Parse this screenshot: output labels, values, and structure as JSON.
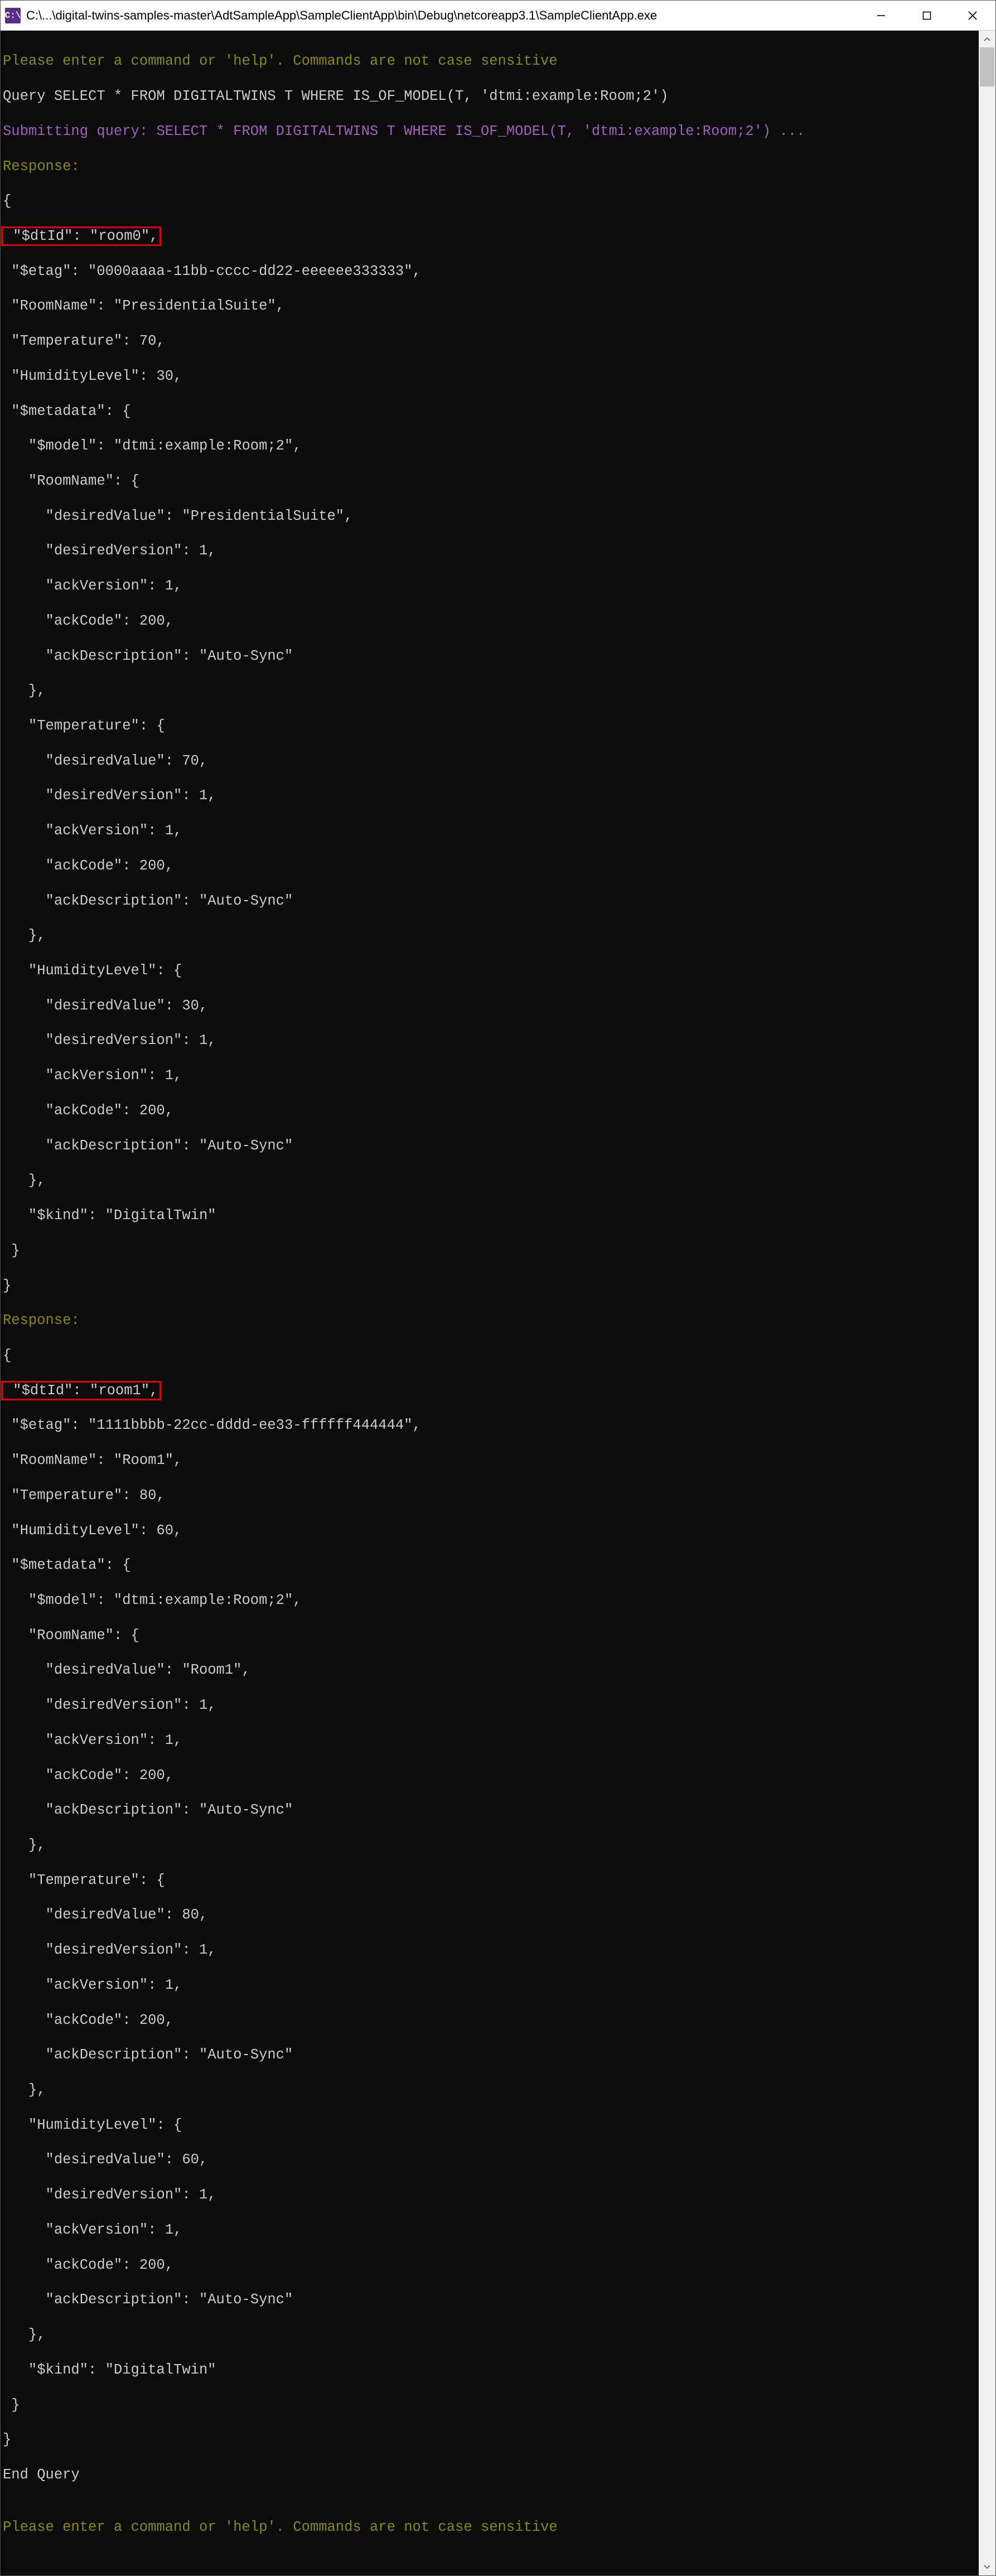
{
  "titlebar": {
    "icon_text": "C:\\",
    "path": "C:\\...\\digital-twins-samples-master\\AdtSampleApp\\SampleClientApp\\bin\\Debug\\netcoreapp3.1\\SampleClientApp.exe"
  },
  "console": {
    "prompt1": "Please enter a command or 'help'. Commands are not case sensitive",
    "query_cmd": "Query SELECT * FROM DIGITALTWINS T WHERE IS_OF_MODEL(T, 'dtmi:example:Room;2')",
    "submitting": "Submitting query: SELECT * FROM DIGITALTWINS T WHERE IS_OF_MODEL(T, 'dtmi:example:Room;2') ...",
    "response_label": "Response:",
    "open_brace": "{",
    "close_brace": "}",
    "r0": {
      "dtid": " \"$dtId\": \"room0\",",
      "etag": " \"$etag\": \"0000aaaa-11bb-cccc-dd22-eeeeee333333\",",
      "roomname": " \"RoomName\": \"PresidentialSuite\",",
      "temp": " \"Temperature\": 70,",
      "hum": " \"HumidityLevel\": 30,",
      "meta_open": " \"$metadata\": {",
      "model": "   \"$model\": \"dtmi:example:Room;2\",",
      "rn_open": "   \"RoomName\": {",
      "rn_dv": "     \"desiredValue\": \"PresidentialSuite\",",
      "rn_dver": "     \"desiredVersion\": 1,",
      "rn_aver": "     \"ackVersion\": 1,",
      "rn_acode": "     \"ackCode\": 200,",
      "rn_adesc": "     \"ackDescription\": \"Auto-Sync\"",
      "rn_close": "   },",
      "t_open": "   \"Temperature\": {",
      "t_dv": "     \"desiredValue\": 70,",
      "t_dver": "     \"desiredVersion\": 1,",
      "t_aver": "     \"ackVersion\": 1,",
      "t_acode": "     \"ackCode\": 200,",
      "t_adesc": "     \"ackDescription\": \"Auto-Sync\"",
      "t_close": "   },",
      "h_open": "   \"HumidityLevel\": {",
      "h_dv": "     \"desiredValue\": 30,",
      "h_dver": "     \"desiredVersion\": 1,",
      "h_aver": "     \"ackVersion\": 1,",
      "h_acode": "     \"ackCode\": 200,",
      "h_adesc": "     \"ackDescription\": \"Auto-Sync\"",
      "h_close": "   },",
      "kind": "   \"$kind\": \"DigitalTwin\"",
      "meta_close": " }"
    },
    "r1": {
      "dtid": " \"$dtId\": \"room1\",",
      "etag": " \"$etag\": \"1111bbbb-22cc-dddd-ee33-ffffff444444\",",
      "roomname": " \"RoomName\": \"Room1\",",
      "temp": " \"Temperature\": 80,",
      "hum": " \"HumidityLevel\": 60,",
      "meta_open": " \"$metadata\": {",
      "model": "   \"$model\": \"dtmi:example:Room;2\",",
      "rn_open": "   \"RoomName\": {",
      "rn_dv": "     \"desiredValue\": \"Room1\",",
      "rn_dver": "     \"desiredVersion\": 1,",
      "rn_aver": "     \"ackVersion\": 1,",
      "rn_acode": "     \"ackCode\": 200,",
      "rn_adesc": "     \"ackDescription\": \"Auto-Sync\"",
      "rn_close": "   },",
      "t_open": "   \"Temperature\": {",
      "t_dv": "     \"desiredValue\": 80,",
      "t_dver": "     \"desiredVersion\": 1,",
      "t_aver": "     \"ackVersion\": 1,",
      "t_acode": "     \"ackCode\": 200,",
      "t_adesc": "     \"ackDescription\": \"Auto-Sync\"",
      "t_close": "   },",
      "h_open": "   \"HumidityLevel\": {",
      "h_dv": "     \"desiredValue\": 60,",
      "h_dver": "     \"desiredVersion\": 1,",
      "h_aver": "     \"ackVersion\": 1,",
      "h_acode": "     \"ackCode\": 200,",
      "h_adesc": "     \"ackDescription\": \"Auto-Sync\"",
      "h_close": "   },",
      "kind": "   \"$kind\": \"DigitalTwin\"",
      "meta_close": " }"
    },
    "end_query": "End Query",
    "prompt2": "Please enter a command or 'help'. Commands are not case sensitive"
  }
}
